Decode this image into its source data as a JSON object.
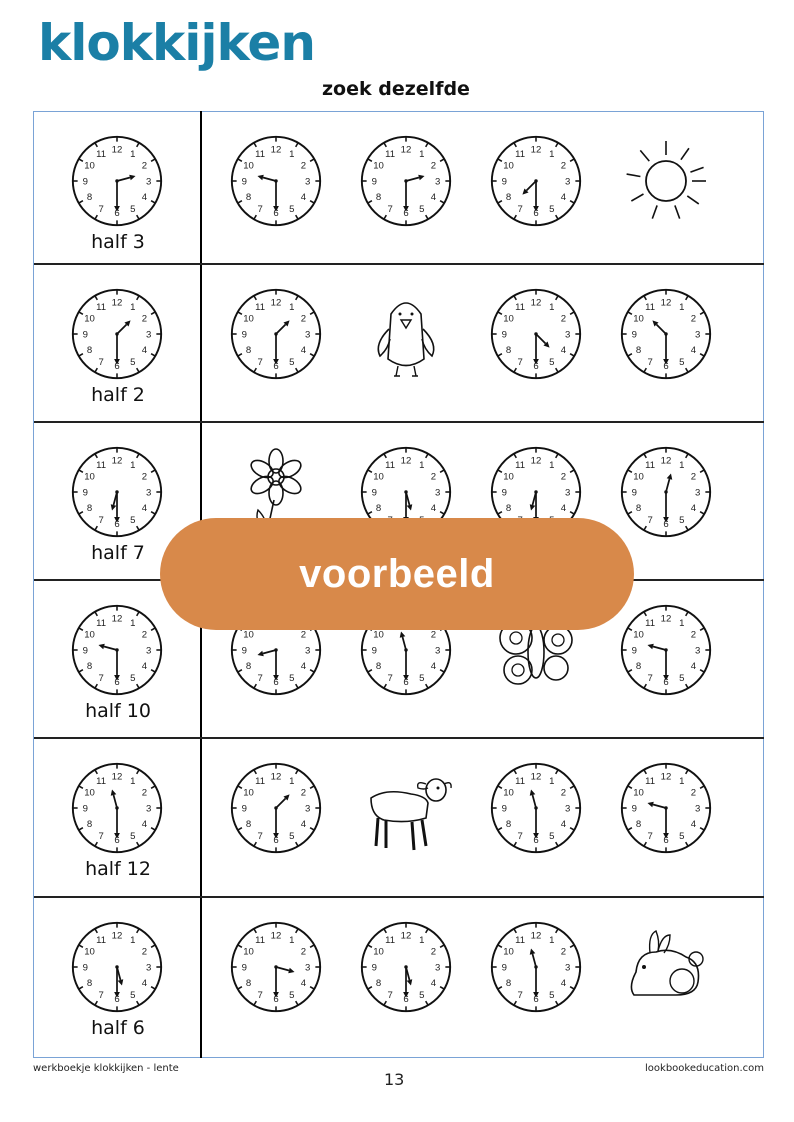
{
  "header": {
    "title": "klokkijken",
    "subtitle": "zoek dezelfde",
    "title_color": "#1b7fa6"
  },
  "rows": [
    {
      "label": "half 3",
      "reference": {
        "hour": 2,
        "minute": 30
      },
      "options": [
        {
          "type": "clock",
          "hour": 9,
          "minute": 30
        },
        {
          "type": "clock",
          "hour": 2,
          "minute": 30
        },
        {
          "type": "clock",
          "hour": 7,
          "minute": 30
        },
        {
          "type": "picture",
          "icon": "sun-icon"
        }
      ]
    },
    {
      "label": "half 2",
      "reference": {
        "hour": 1,
        "minute": 30
      },
      "options": [
        {
          "type": "clock",
          "hour": 1,
          "minute": 30
        },
        {
          "type": "picture",
          "icon": "chick-icon"
        },
        {
          "type": "clock",
          "hour": 4,
          "minute": 30
        },
        {
          "type": "clock",
          "hour": 10,
          "minute": 30
        }
      ]
    },
    {
      "label": "half 7",
      "reference": {
        "hour": 6,
        "minute": 30
      },
      "options": [
        {
          "type": "picture",
          "icon": "flower-icon"
        },
        {
          "type": "clock",
          "hour": 5,
          "minute": 30
        },
        {
          "type": "clock",
          "hour": 6,
          "minute": 30
        },
        {
          "type": "clock",
          "hour": 12,
          "minute": 30
        }
      ]
    },
    {
      "label": "half 10",
      "reference": {
        "hour": 9,
        "minute": 30
      },
      "options": [
        {
          "type": "clock",
          "hour": 8,
          "minute": 30
        },
        {
          "type": "clock",
          "hour": 11,
          "minute": 30
        },
        {
          "type": "picture",
          "icon": "butterfly-icon"
        },
        {
          "type": "clock",
          "hour": 9,
          "minute": 30
        }
      ]
    },
    {
      "label": "half 12",
      "reference": {
        "hour": 11,
        "minute": 30
      },
      "options": [
        {
          "type": "clock",
          "hour": 1,
          "minute": 30
        },
        {
          "type": "picture",
          "icon": "lamb-icon"
        },
        {
          "type": "clock",
          "hour": 11,
          "minute": 30
        },
        {
          "type": "clock",
          "hour": 9,
          "minute": 30
        }
      ]
    },
    {
      "label": "half 6",
      "reference": {
        "hour": 5,
        "minute": 30
      },
      "options": [
        {
          "type": "clock",
          "hour": 3,
          "minute": 30
        },
        {
          "type": "clock",
          "hour": 5,
          "minute": 30
        },
        {
          "type": "clock",
          "hour": 11,
          "minute": 30
        },
        {
          "type": "picture",
          "icon": "rabbit-icon"
        }
      ]
    }
  ],
  "watermark": {
    "text": "voorbeeld",
    "color": "#d8894a"
  },
  "footer": {
    "left": "werkboekje klokkijken - lente",
    "right": "lookbookeducation.com",
    "page_number": "13"
  },
  "clock_numbers": [
    "12",
    "1",
    "2",
    "3",
    "4",
    "5",
    "6",
    "7",
    "8",
    "9",
    "10",
    "11"
  ]
}
